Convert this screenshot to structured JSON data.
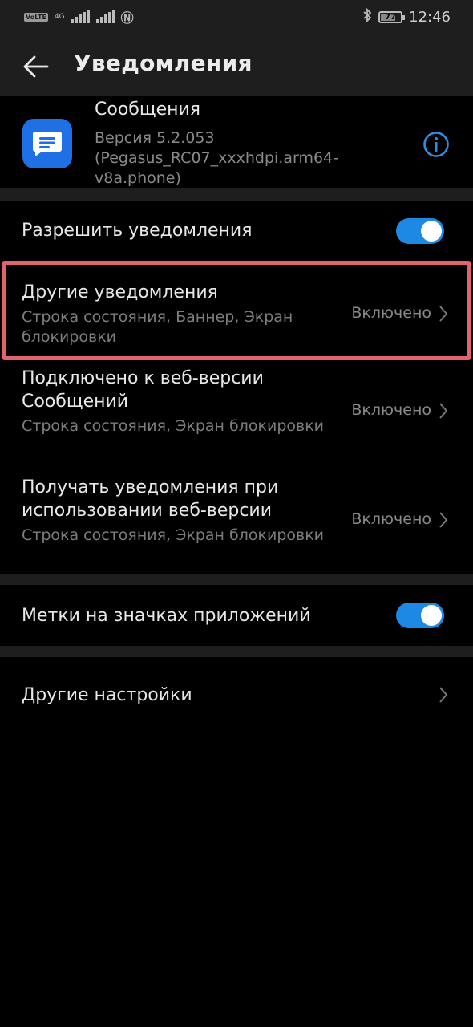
{
  "status_bar": {
    "network_left": "VoLTE",
    "network_type": "4G",
    "battery_level": "77",
    "battery_fraction": 0.77,
    "time": "12:46",
    "icons": [
      "volte-icon",
      "signal-icon",
      "signal-icon",
      "nfc-icon",
      "bluetooth-icon",
      "battery-icon"
    ]
  },
  "app_bar": {
    "title": "Уведомления",
    "back_icon": "arrow-left-icon"
  },
  "app_info": {
    "name": "Сообщения",
    "version": "Версия 5.2.053 (Pegasus_RC07_xxxhdpi.arm64-v8a.phone)",
    "icon": "messages-icon",
    "info_icon": "info-icon"
  },
  "settings": {
    "allow_notifications": {
      "label": "Разрешить уведомления",
      "enabled": true
    },
    "other_notifications": {
      "title": "Другие уведомления",
      "subtitle": "Строка состояния, Баннер, Экран блокировки",
      "value": "Включено"
    },
    "web_connected": {
      "title": "Подключено к веб-версии Сообщений",
      "subtitle": "Строка состояния, Экран блокировки",
      "value": "Включено"
    },
    "web_usage": {
      "title": "Получать уведомления при использовании веб-версии",
      "subtitle": "Строка состояния, Экран блокировки",
      "value": "Включено"
    },
    "badges": {
      "label": "Метки на значках приложений",
      "enabled": true
    },
    "other_settings": {
      "title": "Другие настройки"
    }
  },
  "colors": {
    "background": "#000000",
    "surface": "#1e1e1e",
    "accent": "#1e88e5",
    "highlight": "#e2636b"
  }
}
